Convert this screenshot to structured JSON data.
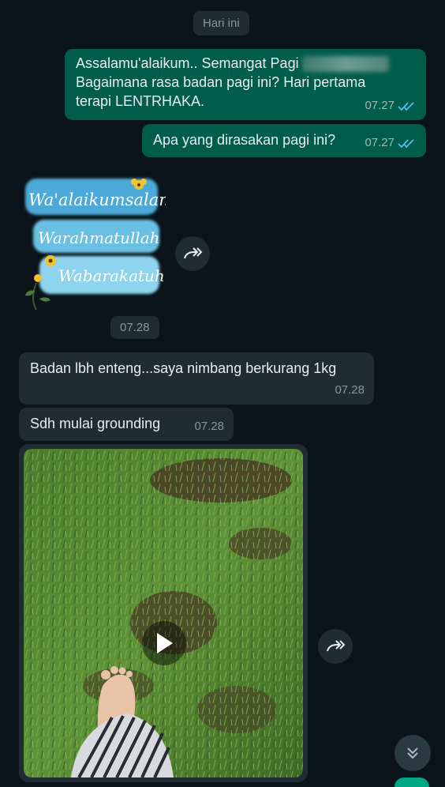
{
  "date_chip": "Hari ini",
  "messages": {
    "m1": {
      "line1": "Assalamu'alaikum.. Semangat Pagi",
      "line2": "Bagaimana rasa badan pagi ini? Hari pertama",
      "line3": "terapi LENTRHAKA.",
      "time": "07.27"
    },
    "m2": {
      "text": "Apa yang dirasakan pagi ini?",
      "time": "07.27"
    },
    "sticker": {
      "line1": "Wa'alaikumsalam",
      "line2": "Warahmatullah",
      "line3": "Wabarakatuh",
      "time": "07.28"
    },
    "m3": {
      "text": "Badan lbh enteng...saya nimbang berkurang 1kg",
      "time": "07.28"
    },
    "m4": {
      "text": "Sdh mulai grounding",
      "time": "07.28"
    }
  },
  "colors": {
    "background": "#0b141a",
    "outgoing": "#005c4b",
    "incoming": "#1f2c34",
    "read_ticks": "#53bdeb"
  },
  "icons": {
    "forward": "forward-icon",
    "play": "play-icon",
    "scroll_down": "double-chevron-down-icon",
    "ticks": "double-check-icon"
  }
}
